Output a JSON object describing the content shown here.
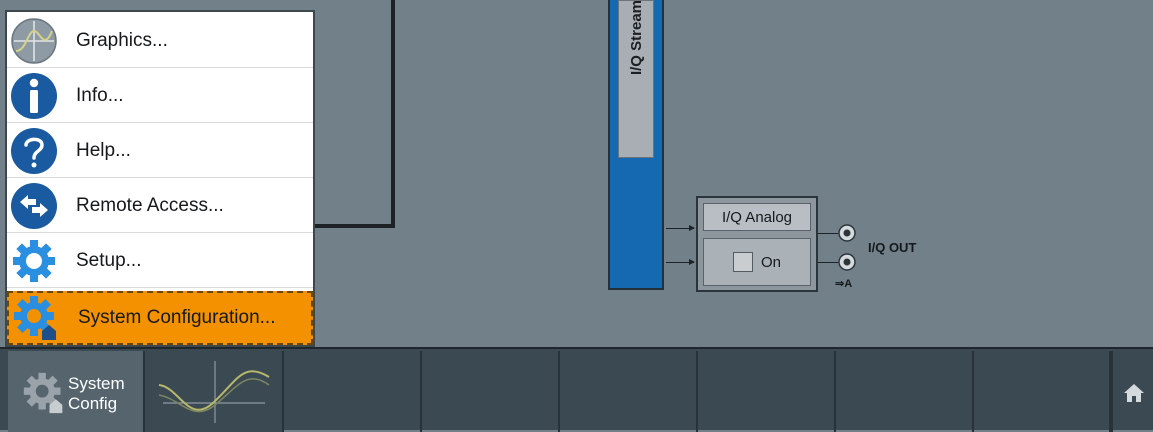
{
  "menu": {
    "items": [
      {
        "label": "Graphics...",
        "icon": "graphics-icon"
      },
      {
        "label": "Info...",
        "icon": "info-icon"
      },
      {
        "label": "Help...",
        "icon": "help-icon"
      },
      {
        "label": "Remote Access...",
        "icon": "remote-access-icon"
      },
      {
        "label": "Setup...",
        "icon": "gear-icon"
      },
      {
        "label": "System Configuration...",
        "icon": "system-config-icon",
        "selected": true
      }
    ]
  },
  "diagram": {
    "stream_label": "I/Q Stream",
    "iq_analog": {
      "title": "I/Q Analog",
      "state_label": "On",
      "checked": false
    },
    "output_label": "I/Q OUT",
    "output_marker": "⇒A"
  },
  "taskbar": {
    "system_config_line1": "System",
    "system_config_line2": "Config",
    "home_icon": "home-icon"
  },
  "colors": {
    "background": "#728189",
    "stream": "#1569b0",
    "selected": "#f49100",
    "taskbar": "#3b4953",
    "icon_blue": "#1a5aa0",
    "icon_light_blue": "#2a8fe0"
  }
}
